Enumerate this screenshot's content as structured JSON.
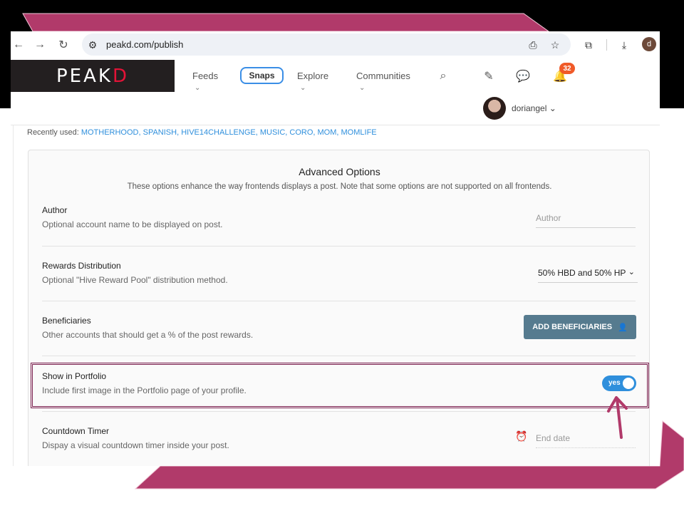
{
  "browser": {
    "url": "peakd.com/publish",
    "profile_initial": "d"
  },
  "header": {
    "logo": "PEAKD",
    "nav": [
      "Feeds",
      "Snaps",
      "Explore",
      "Communities"
    ],
    "notification_count": "32",
    "username": "doriangel"
  },
  "recent": {
    "label": "Recently used:",
    "tags": "MOTHERHOOD, SPANISH, HIVE14CHALLENGE, MUSIC, CORO, MOM, MOMLIFE"
  },
  "advanced": {
    "title": "Advanced Options",
    "subtitle": "These options enhance the way frontends displays a post. Note that some options are not supported on all frontends.",
    "options": [
      {
        "title": "Author",
        "desc": "Optional account name to be displayed on post.",
        "placeholder": "Author"
      },
      {
        "title": "Rewards Distribution",
        "desc": "Optional \"Hive Reward Pool\" distribution method.",
        "value": "50% HBD and 50% HP"
      },
      {
        "title": "Beneficiaries",
        "desc": "Other accounts that should get a % of the post rewards.",
        "button": "ADD BENEFICIARIES"
      },
      {
        "title": "Show in Portfolio",
        "desc": "Include first image in the Portfolio page of your profile.",
        "toggle": "yes"
      },
      {
        "title": "Countdown Timer",
        "desc": "Dispay a visual countdown timer inside your post.",
        "placeholder": "End date"
      }
    ]
  },
  "colors": {
    "accent": "#2f8fdc",
    "highlight_frame": "#7a1e4e",
    "decoration": "#b13a6a",
    "button": "#567b8f"
  }
}
